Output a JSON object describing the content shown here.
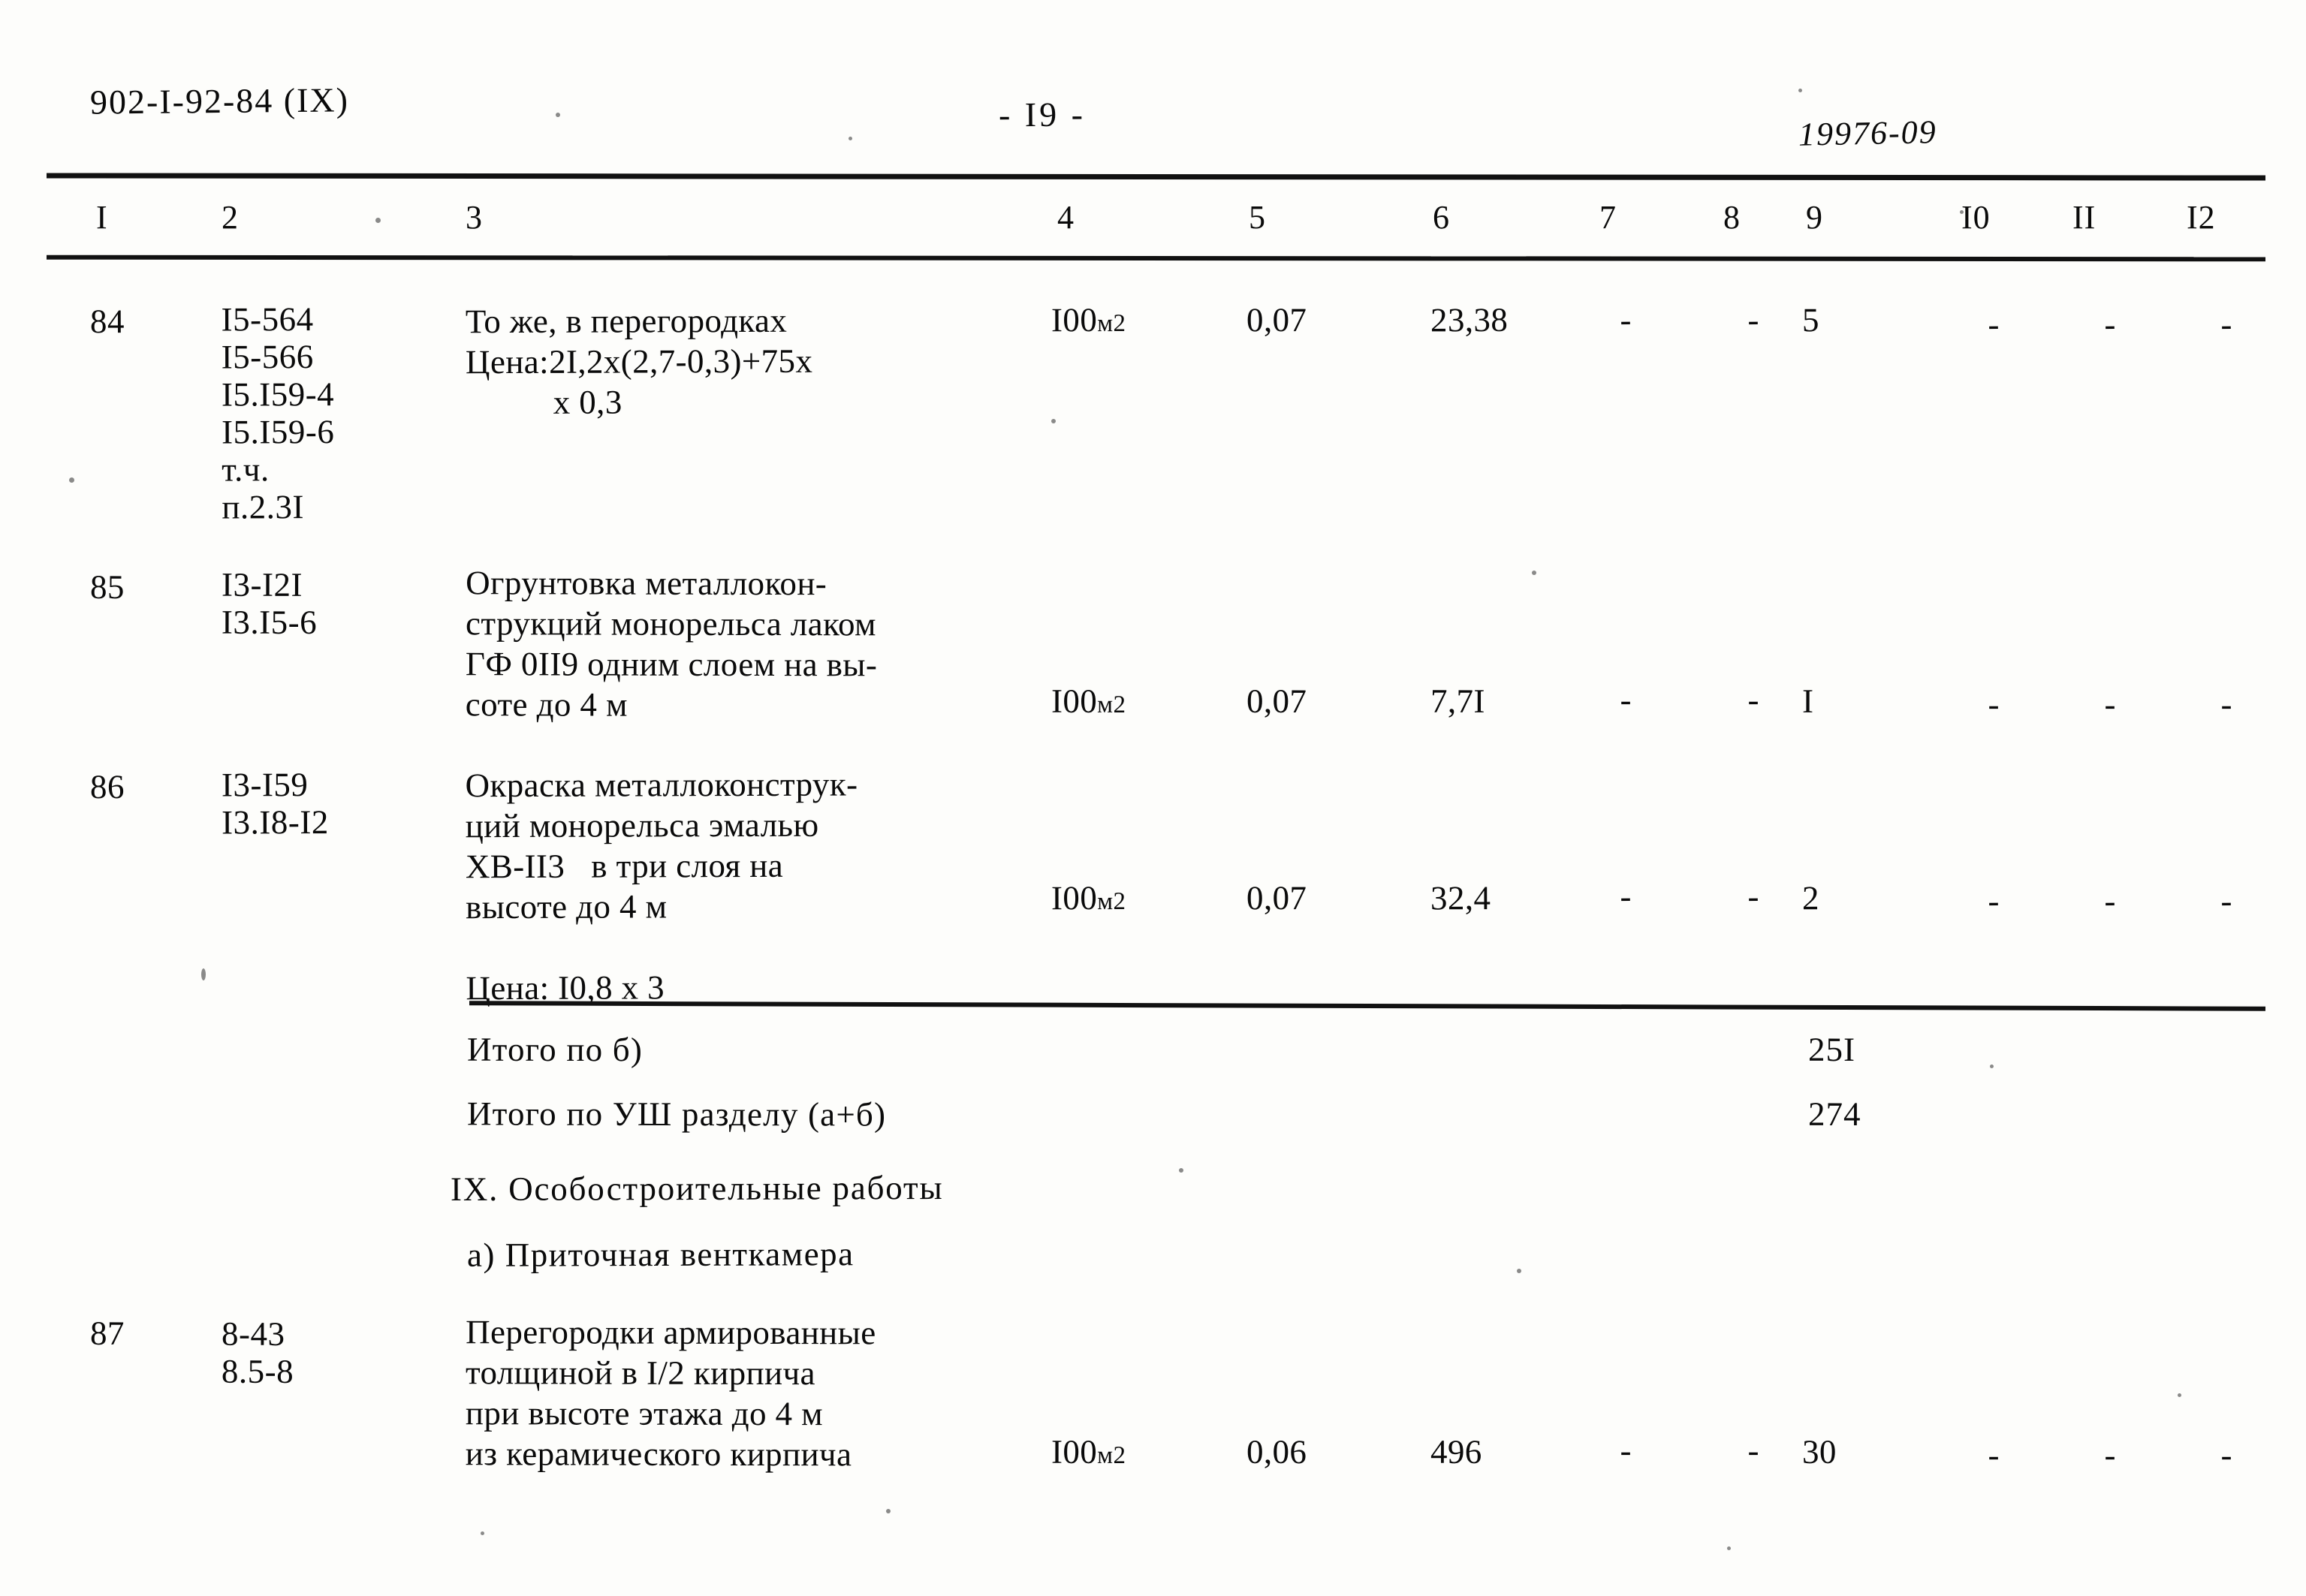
{
  "header": {
    "doc_code": "902-I-92-84  (IX)",
    "page_marker": "-  I9  -",
    "archive_code": "19976-09"
  },
  "table": {
    "column_headers": [
      "I",
      "2",
      "3",
      "4",
      "5",
      "6",
      "7",
      "8",
      "9",
      "I0",
      "II",
      "I2"
    ],
    "rows": [
      {
        "num": "84",
        "codes": "I5-564\nI5-566\nI5.I59-4\nI5.I59-6\nт.ч.\nп.2.3I",
        "description": "То же, в перегородках\nЦена:2I,2х(2,7-0,3)+75х\n          х 0,3",
        "unit": "I00",
        "unit_sub": "м2",
        "c5": "0,07",
        "c6": "23,38",
        "c7": "-",
        "c8": "-",
        "c9": "5",
        "c10": "-",
        "c11": "-",
        "c12": "-"
      },
      {
        "num": "85",
        "codes": "I3-I2I\nI3.I5-6",
        "description": "Огрунтовка металлокон-\nструкций монорельса лаком\nГФ 0II9 одним слоем на вы-\nсоте до 4 м",
        "unit": "I00",
        "unit_sub": "м2",
        "c5": "0,07",
        "c6": "7,7I",
        "c7": "-",
        "c8": "-",
        "c9": "I",
        "c10": "-",
        "c11": "-",
        "c12": "-"
      },
      {
        "num": "86",
        "codes": "I3-I59\nI3.I8-I2",
        "description": "Окраска металлоконструк-\nций монорельса эмалью\nХВ-II3   в три слоя на\nвысоте до 4 м\n\nЦена: I0,8 х 3",
        "unit": "I00",
        "unit_sub": "м2",
        "c5": "0,07",
        "c6": "32,4",
        "c7": "-",
        "c8": "-",
        "c9": "2",
        "c10": "-",
        "c11": "-",
        "c12": "-"
      },
      {
        "num": "87",
        "codes": "8-43\n8.5-8",
        "description": "Перегородки армированные\nтолщиной в I/2 кирпича\nпри высоте этажа до 4 м\nиз керамического кирпича",
        "unit": "I00",
        "unit_sub": "м2",
        "c5": "0,06",
        "c6": "496",
        "c7": "-",
        "c8": "-",
        "c9": "30",
        "c10": "-",
        "c11": "-",
        "c12": "-"
      }
    ],
    "summaries": [
      {
        "label": "Итого по б)",
        "value": "25I"
      },
      {
        "label": "Итого по УШ разделу (а+б)",
        "value": "274"
      }
    ],
    "section": {
      "title": "IX. Особостроительные работы",
      "subtitle": "а) Приточная венткамера"
    }
  }
}
